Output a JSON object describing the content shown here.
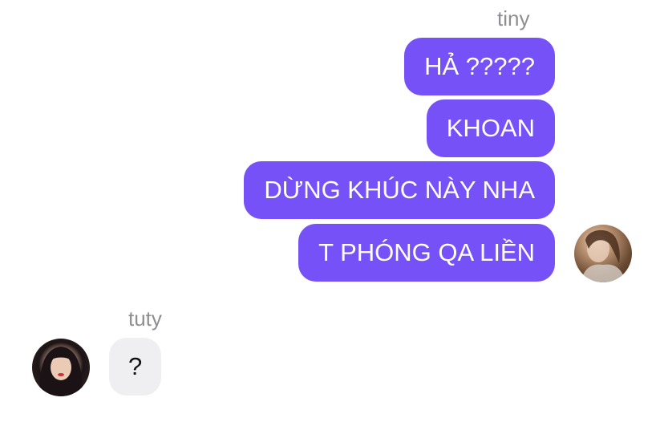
{
  "conversation": {
    "outgoing": {
      "sender": "tiny",
      "messages": [
        "HẢ ?????",
        "KHOAN",
        "DỪNG KHÚC NÀY NHA",
        "T PHÓNG QA LIỀN"
      ],
      "bubble_color": "#7551f7",
      "avatar_icon": "user-photo"
    },
    "incoming": {
      "sender": "tuty",
      "messages": [
        "?"
      ],
      "bubble_color": "#efeff2",
      "avatar_icon": "user-photo"
    }
  }
}
